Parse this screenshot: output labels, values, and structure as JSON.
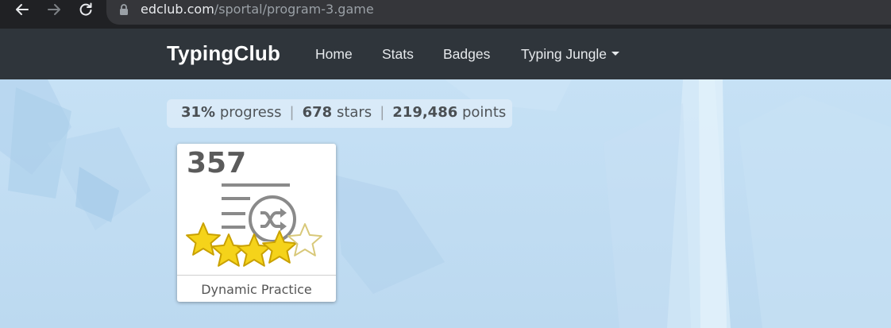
{
  "browser": {
    "url_domain": "edclub.com",
    "url_path": "/sportal/program-3.game",
    "icons": [
      "back-arrow-icon",
      "forward-arrow-icon",
      "reload-icon",
      "lock-icon"
    ]
  },
  "navbar": {
    "brand": "TypingClub",
    "links": [
      {
        "label": "Home"
      },
      {
        "label": "Stats"
      },
      {
        "label": "Badges"
      },
      {
        "label": "Typing Jungle",
        "dropdown": true
      }
    ]
  },
  "progress": {
    "percent": "31%",
    "percent_label": "progress",
    "stars": "678",
    "stars_label": "stars",
    "points": "219,486",
    "points_label": "points",
    "separator": "|"
  },
  "lesson_card": {
    "number": "357",
    "title": "Dynamic Practice",
    "icon": "shuffle-lines-icon",
    "rating": {
      "filled": 4,
      "total": 5
    }
  },
  "colors": {
    "browser_bar": "#202124",
    "navbar": "#2f353b",
    "background": "#c2def4",
    "star_fill": "#f5d31a"
  }
}
